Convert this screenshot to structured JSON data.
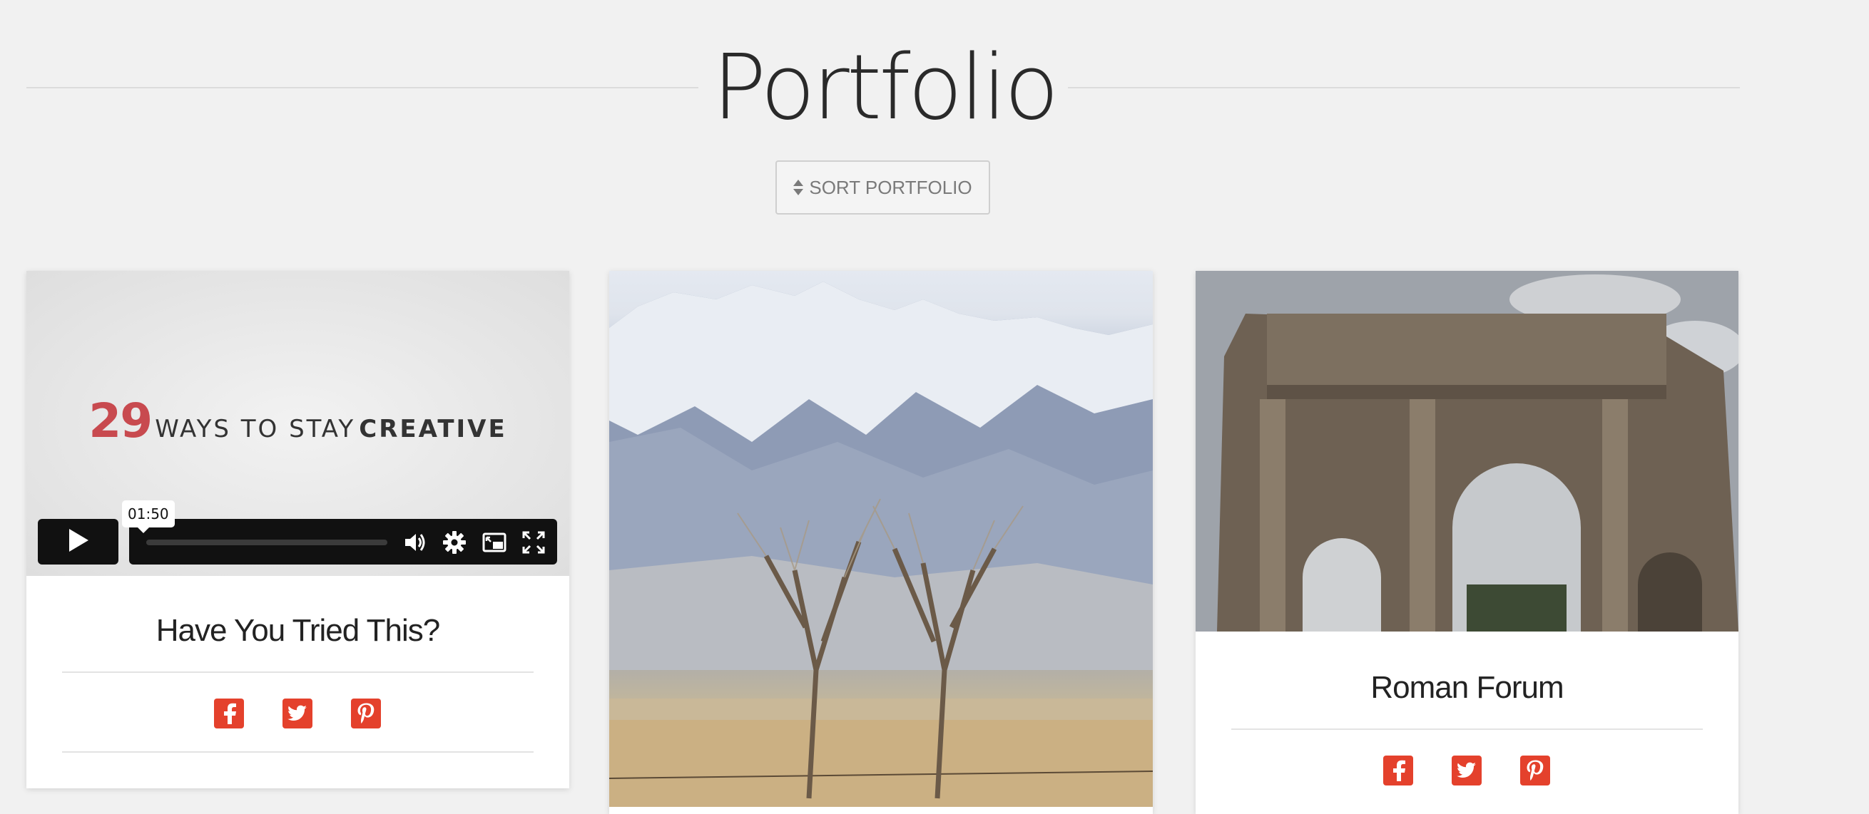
{
  "header": {
    "title": "Portfolio",
    "sort_label": "SORT PORTFOLIO"
  },
  "cards": [
    {
      "type": "video",
      "video": {
        "heading_number": "29",
        "heading_middle": "WAYS TO STAY",
        "heading_strong": "CREATIVE",
        "time": "01:50",
        "progress": 0
      },
      "title": "Have You Tried This?",
      "share": [
        "facebook-icon",
        "twitter-icon",
        "pinterest-icon"
      ]
    },
    {
      "type": "image",
      "image": "snowy mountains with bare trees"
    },
    {
      "type": "image",
      "image": "ancient roman triumphal arch",
      "title": "Roman Forum",
      "share": [
        "facebook-icon",
        "twitter-icon",
        "pinterest-icon"
      ]
    }
  ],
  "colors": {
    "background": "#f1f1f1",
    "accent": "#e4412c",
    "video_number": "#c84a4f"
  }
}
